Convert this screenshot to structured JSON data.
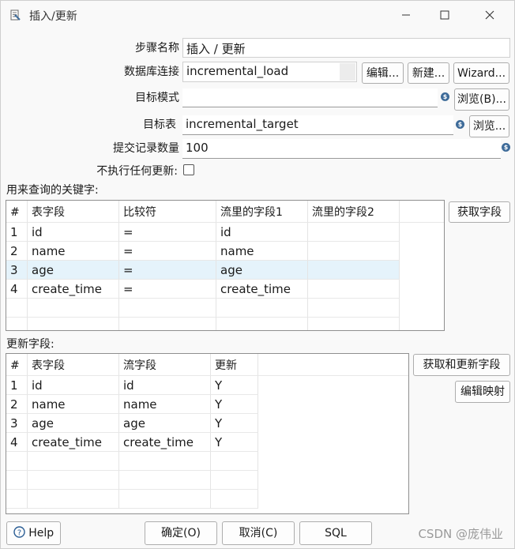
{
  "window": {
    "title": "插入/更新",
    "controls": {
      "minimize": "—",
      "maximize": "☐",
      "close": "✕"
    }
  },
  "form": {
    "step_name_label": "步骤名称",
    "step_name_value": "插入 / 更新",
    "db_conn_label": "数据库连接",
    "db_conn_value": "incremental_load",
    "edit_btn": "编辑...",
    "new_btn": "新建...",
    "wizard_btn": "Wizard...",
    "target_schema_label": "目标模式",
    "target_schema_value": "",
    "browse_schema_btn": "浏览(B)...",
    "target_table_label": "目标表",
    "target_table_value": "incremental_target",
    "browse_table_btn": "浏览...",
    "commit_size_label": "提交记录数量",
    "commit_size_value": "100",
    "no_update_label": "不执行任何更新:",
    "no_update_checked": false
  },
  "lookup": {
    "section_label": "用来查询的关键字:",
    "get_fields_btn": "获取字段",
    "columns": [
      "#",
      "表字段",
      "比较符",
      "流里的字段1",
      "流里的字段2"
    ],
    "rows": [
      [
        "1",
        "id",
        "=",
        "id",
        ""
      ],
      [
        "2",
        "name",
        "=",
        "name",
        ""
      ],
      [
        "3",
        "age",
        "=",
        "age",
        ""
      ],
      [
        "4",
        "create_time",
        "=",
        "create_time",
        ""
      ]
    ]
  },
  "update": {
    "section_label": "更新字段:",
    "get_update_fields_btn": "获取和更新字段",
    "edit_mapping_btn": "编辑映射",
    "columns": [
      "#",
      "表字段",
      "流字段",
      "更新"
    ],
    "rows": [
      [
        "1",
        "id",
        "id",
        "Y"
      ],
      [
        "2",
        "name",
        "name",
        "Y"
      ],
      [
        "3",
        "age",
        "age",
        "Y"
      ],
      [
        "4",
        "create_time",
        "create_time",
        "Y"
      ]
    ]
  },
  "footer": {
    "help_btn": "Help",
    "ok_btn": "确定(O)",
    "cancel_btn": "取消(C)",
    "sql_btn": "SQL",
    "watermark": "CSDN @庞伟业"
  }
}
